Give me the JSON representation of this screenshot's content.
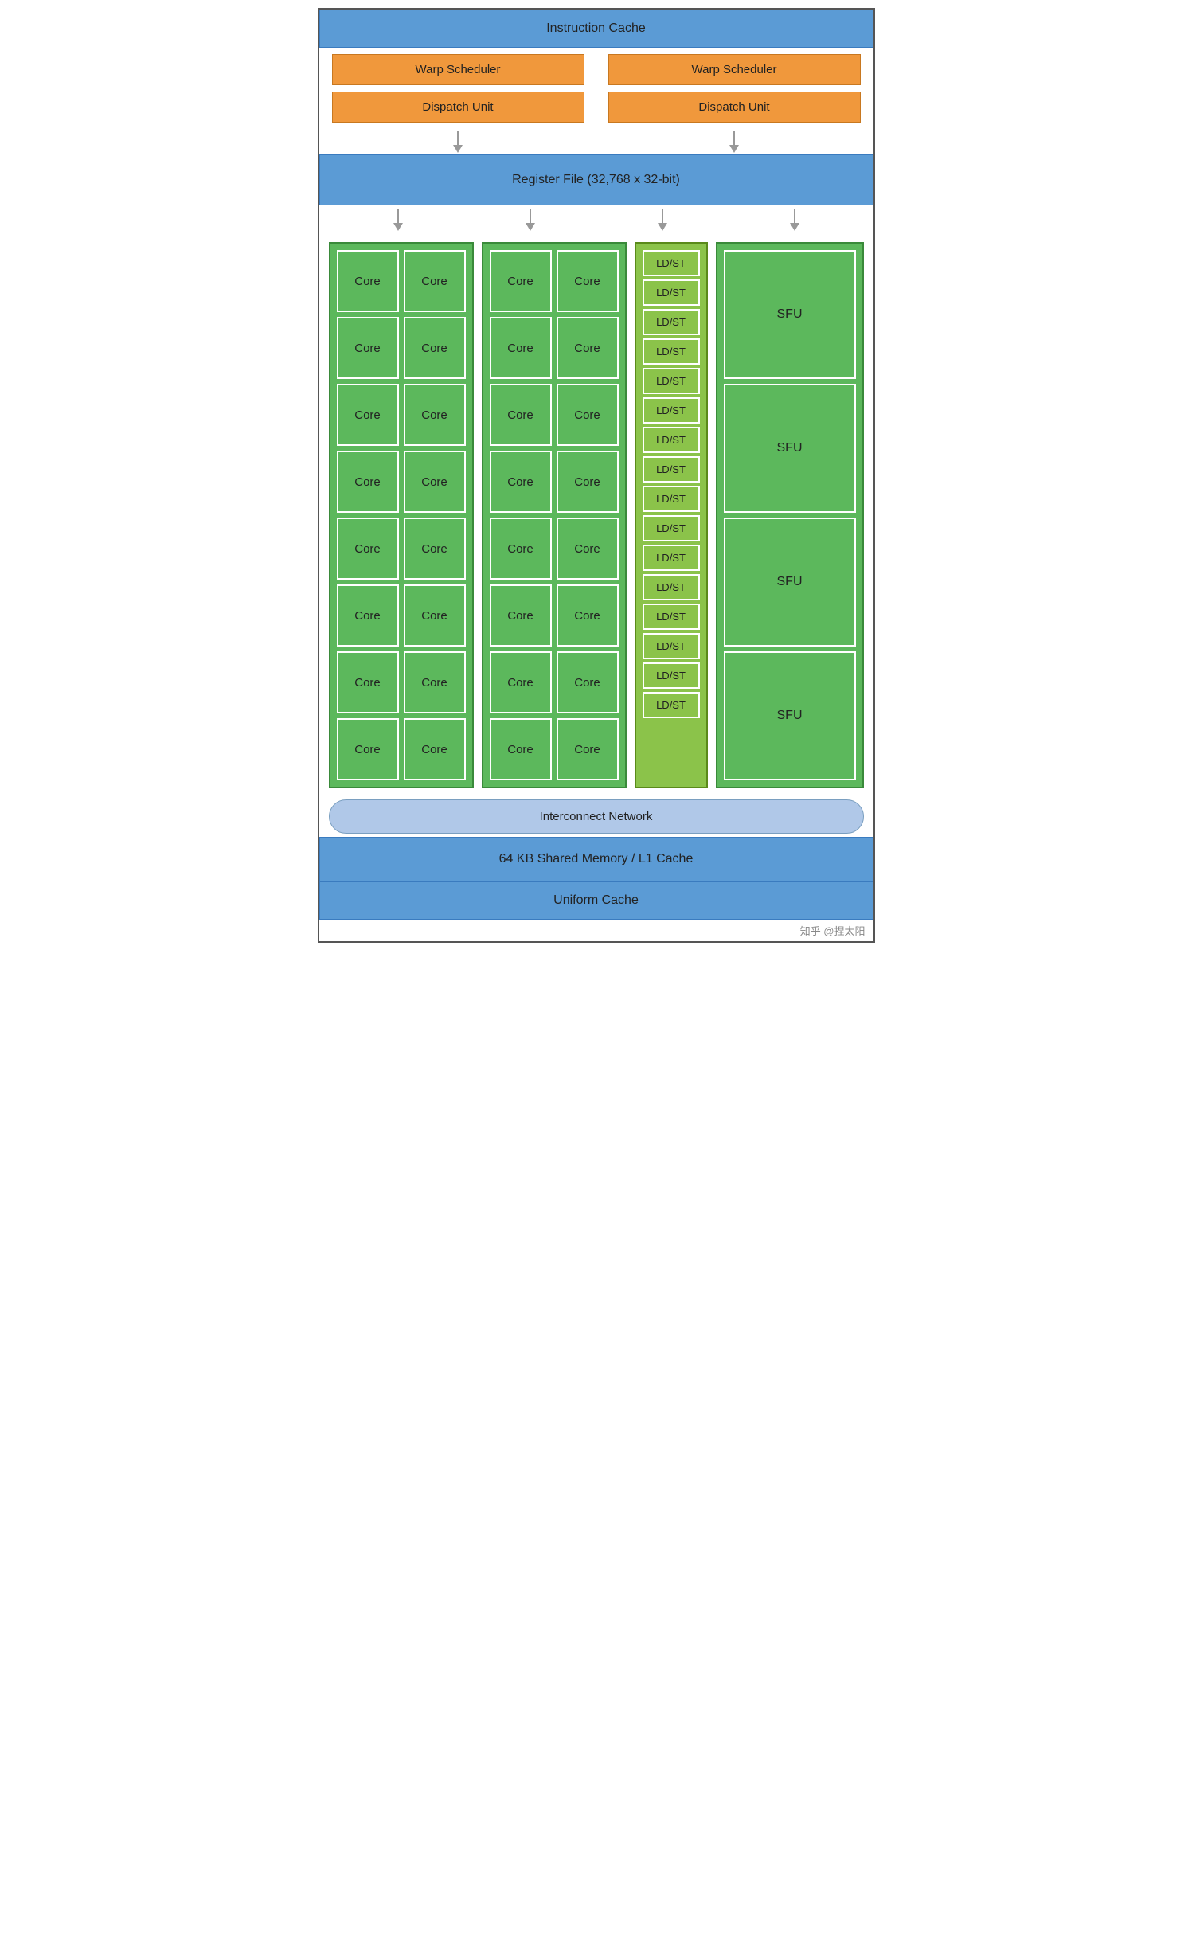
{
  "header": {
    "instruction_cache": "Instruction Cache"
  },
  "schedulers": [
    {
      "label": "Warp Scheduler"
    },
    {
      "label": "Warp Scheduler"
    }
  ],
  "dispatch_units": [
    {
      "label": "Dispatch Unit"
    },
    {
      "label": "Dispatch Unit"
    }
  ],
  "register_file": {
    "label": "Register File (32,768 x 32-bit)"
  },
  "core_columns": [
    {
      "id": "col1",
      "cores": [
        [
          "Core",
          "Core"
        ],
        [
          "Core",
          "Core"
        ],
        [
          "Core",
          "Core"
        ],
        [
          "Core",
          "Core"
        ],
        [
          "Core",
          "Core"
        ],
        [
          "Core",
          "Core"
        ],
        [
          "Core",
          "Core"
        ],
        [
          "Core",
          "Core"
        ]
      ]
    },
    {
      "id": "col2",
      "cores": [
        [
          "Core",
          "Core"
        ],
        [
          "Core",
          "Core"
        ],
        [
          "Core",
          "Core"
        ],
        [
          "Core",
          "Core"
        ],
        [
          "Core",
          "Core"
        ],
        [
          "Core",
          "Core"
        ],
        [
          "Core",
          "Core"
        ],
        [
          "Core",
          "Core"
        ]
      ]
    }
  ],
  "ldst_units": [
    "LD/ST",
    "LD/ST",
    "LD/ST",
    "LD/ST",
    "LD/ST",
    "LD/ST",
    "LD/ST",
    "LD/ST",
    "LD/ST",
    "LD/ST",
    "LD/ST",
    "LD/ST",
    "LD/ST",
    "LD/ST",
    "LD/ST",
    "LD/ST"
  ],
  "sfu_units": [
    {
      "label": "SFU"
    },
    {
      "label": "SFU"
    },
    {
      "label": "SFU"
    },
    {
      "label": "SFU"
    }
  ],
  "interconnect": {
    "label": "Interconnect Network"
  },
  "shared_memory": {
    "label": "64 KB Shared Memory / L1 Cache"
  },
  "uniform_cache": {
    "label": "Uniform Cache"
  },
  "watermark": "知乎 @捏太阳"
}
